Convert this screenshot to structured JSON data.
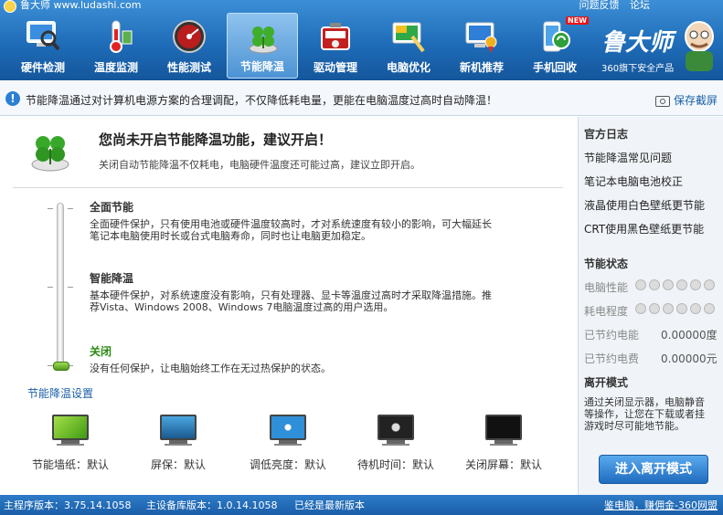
{
  "titlebar": {
    "app_name": "鲁大师 www.ludashi.com",
    "feedback": "问题反馈",
    "forum": "论坛"
  },
  "nav": {
    "items": [
      {
        "label": "硬件检测",
        "icon": "monitor-magnifier-icon"
      },
      {
        "label": "温度监测",
        "icon": "thermometer-icon"
      },
      {
        "label": "性能测试",
        "icon": "speedometer-icon"
      },
      {
        "label": "节能降温",
        "icon": "clover-icon",
        "active": true
      },
      {
        "label": "驱动管理",
        "icon": "toolbox-icon"
      },
      {
        "label": "电脑优化",
        "icon": "screen-brush-icon"
      },
      {
        "label": "新机推荐",
        "icon": "monitor-medal-icon"
      },
      {
        "label": "手机回收",
        "icon": "phone-recycle-icon",
        "badge": "NEW"
      }
    ]
  },
  "brand": {
    "name": "鲁大师",
    "sub": "360旗下安全产品"
  },
  "infobar": {
    "text": "节能降温通过对计算机电源方案的合理调配，不仅降低耗电量，更能在电脑温度过高时自动降温！",
    "save_label": "保存截屏"
  },
  "main": {
    "title": "您尚未开启节能降温功能，建议开启！",
    "subtitle": "关闭自动节能降温不仅耗电，电脑硬件温度还可能过高，建议立即开启。",
    "modes": [
      {
        "title": "全面节能",
        "desc_lines": [
          "全面硬件保护，只有使用电池或硬件温度较高时，才对系统速度有较小的影响，可大幅延长",
          "笔记本电脑使用时长或台式电脑寿命，同时也让电脑更加稳定。"
        ]
      },
      {
        "title": "智能降温",
        "desc_lines": [
          "基本硬件保护，对系统速度没有影响，只有处理器、显卡等温度过高时才采取降温措施。推",
          "荐Vista、Windows 2008、Windows 7电脑温度过高的用户选用。"
        ]
      },
      {
        "title": "关闭",
        "desc_lines": [
          "没有任何保护，让电脑始终工作在无过热保护的状态。"
        ]
      }
    ],
    "selected_mode_index": 2,
    "settings_link": "节能降温设置",
    "monitors": [
      {
        "label": "节能墙纸：默认",
        "icon": "wallpaper-monitor-icon",
        "screen_color": "#6cc22c"
      },
      {
        "label": "屏保：默认",
        "icon": "screensaver-monitor-icon",
        "screen_color": "#2a7ab8"
      },
      {
        "label": "调低亮度：默认",
        "icon": "brightness-monitor-icon",
        "screen_color": "#2f8fd8"
      },
      {
        "label": "待机时间：默认",
        "icon": "standby-monitor-icon",
        "screen_color": "#222222"
      },
      {
        "label": "关闭屏幕：默认",
        "icon": "screen-off-monitor-icon",
        "screen_color": "#111111"
      }
    ]
  },
  "sidebar": {
    "official_log_title": "官方日志",
    "links": [
      "节能降温常见问题",
      "笔记本电脑电池校正",
      "液晶使用白色壁纸更节能",
      "CRT使用黑色壁纸更节能"
    ],
    "status_title": "节能状态",
    "performance_label": "电脑性能",
    "power_label": "耗电程度",
    "saved_power_label": "已节约电能",
    "saved_power_value": "0.00000度",
    "saved_cost_label": "已节约电费",
    "saved_cost_value": "0.00000元",
    "leave_mode_title": "离开模式",
    "leave_mode_desc_lines": [
      "通过关闭显示器，电脑静音",
      "等操作，让您在下载或者挂",
      "游戏时尽可能地节能。"
    ],
    "leave_mode_button": "进入离开模式"
  },
  "statusbar": {
    "main_version": "主程序版本：3.75.14.1058",
    "db_version": "主设备库版本：1.0.14.1058",
    "latest": "已经是最新版本",
    "right_link": "鉴电脑，赚佣金-360网盟"
  }
}
